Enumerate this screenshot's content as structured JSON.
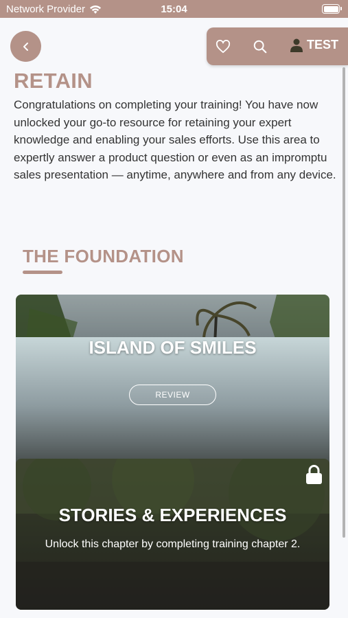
{
  "status_bar": {
    "carrier": "Network Provider",
    "time": "15:04"
  },
  "toolbar": {
    "user_label": "TEST"
  },
  "page": {
    "title": "RETAIN",
    "intro": "Congratulations on completing your training! You have now unlocked your go-to resource for retaining your expert knowledge and enabling your sales efforts. Use this area to expertly answer a product question or even as an impromptu sales presentation — anytime, anywhere and from any device."
  },
  "section": {
    "title": "THE FOUNDATION"
  },
  "cards": [
    {
      "title": "ISLAND OF SMILES",
      "button_label": "REVIEW"
    },
    {
      "title": "STORIES & EXPERIENCES",
      "description": "Unlock this chapter by completing training chapter 2."
    }
  ],
  "colors": {
    "accent": "#b49288",
    "text": "#333333",
    "background": "#f7f8fb"
  }
}
